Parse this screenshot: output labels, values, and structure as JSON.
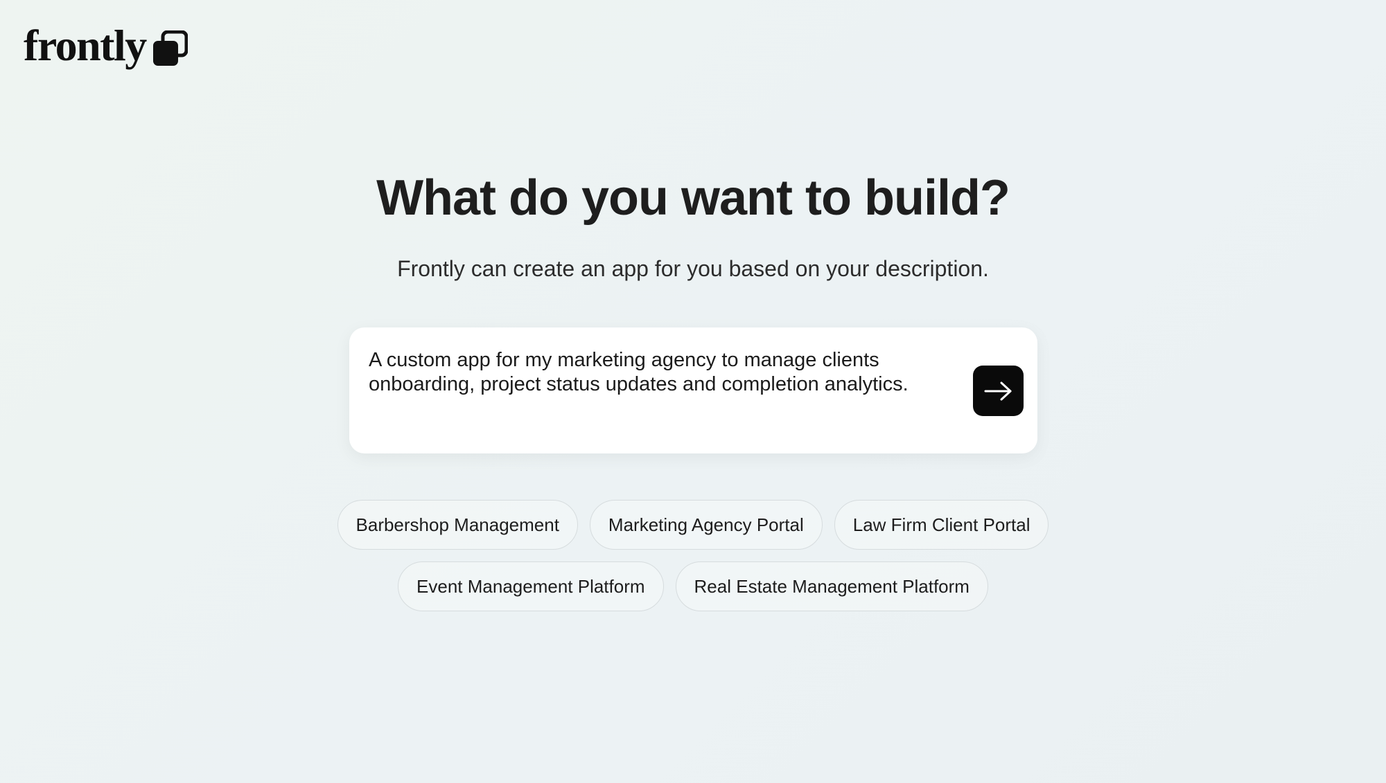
{
  "brand": {
    "name": "frontly",
    "logo_icon": "stacked-squares-icon",
    "color": "#111111"
  },
  "hero": {
    "title": "What do you want to build?",
    "subtitle": "Frontly can create an app for you based on your description."
  },
  "prompt": {
    "value": "A custom app for my marketing agency to manage clients onboarding, project status updates and completion analytics.",
    "submit_icon": "arrow-right-icon",
    "submit_color": "#0a0a0a"
  },
  "suggestions": {
    "row1": [
      {
        "label": "Barbershop Management"
      },
      {
        "label": "Marketing Agency Portal"
      },
      {
        "label": "Law Firm Client Portal"
      }
    ],
    "row2": [
      {
        "label": "Event Management Platform"
      },
      {
        "label": "Real Estate Management Platform"
      }
    ]
  }
}
